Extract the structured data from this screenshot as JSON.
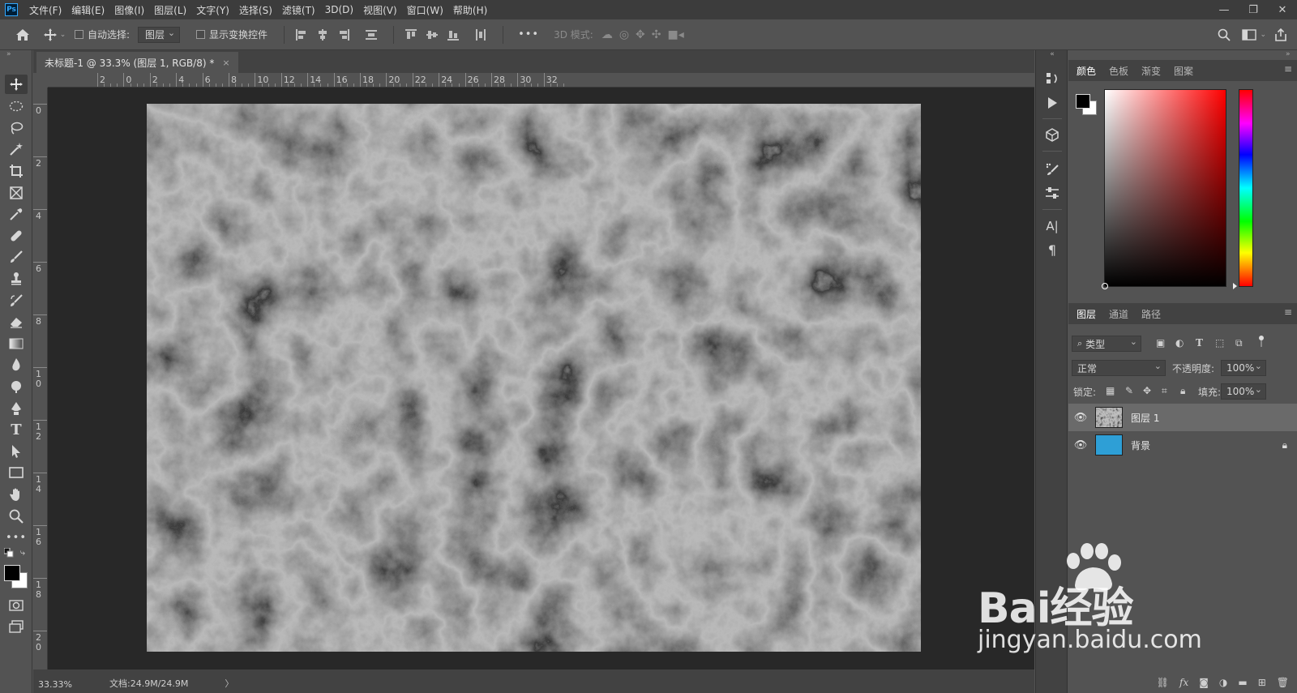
{
  "app": {
    "logo_text": "Ps"
  },
  "menu": [
    "文件(F)",
    "编辑(E)",
    "图像(I)",
    "图层(L)",
    "文字(Y)",
    "选择(S)",
    "滤镜(T)",
    "3D(D)",
    "视图(V)",
    "窗口(W)",
    "帮助(H)"
  ],
  "window_controls": {
    "minimize": "—",
    "restore": "❐",
    "close": "✕"
  },
  "options_bar": {
    "auto_select_label": "自动选择:",
    "auto_select_target": "图层",
    "show_transform_label": "显示变换控件",
    "more_label": "•••",
    "mode_3d_label": "3D 模式:"
  },
  "document": {
    "tab_title": "未标题-1 @ 33.3% (图层 1, RGB/8) *",
    "tab_close": "×",
    "ruler_h_labels": [
      "2",
      "0",
      "2",
      "4",
      "6",
      "8",
      "10",
      "12",
      "14",
      "16",
      "18",
      "20",
      "22",
      "24",
      "26",
      "28",
      "30",
      "32"
    ],
    "ruler_v_labels": [
      "0",
      "2",
      "4",
      "6",
      "8",
      "10",
      "12",
      "14",
      "16",
      "18",
      "20"
    ]
  },
  "status": {
    "zoom": "33.33%",
    "doc_size": "文档:24.9M/24.9M",
    "arrow": "〉"
  },
  "color_panel": {
    "tabs": [
      "颜色",
      "色板",
      "渐变",
      "图案"
    ],
    "active_tab": 0,
    "foreground": "#000000",
    "background": "#ffffff",
    "hue": "#ff0000"
  },
  "layers_panel": {
    "tabs": [
      "图层",
      "通道",
      "路径"
    ],
    "active_tab": 0,
    "filter_label": "类型",
    "blend_mode": "正常",
    "opacity_label": "不透明度:",
    "opacity_value": "100%",
    "lock_label": "锁定:",
    "fill_label": "填充:",
    "fill_value": "100%",
    "layers": [
      {
        "name": "图层 1",
        "selected": true,
        "visible": true,
        "locked": false
      },
      {
        "name": "背景",
        "selected": false,
        "visible": true,
        "locked": true,
        "color": "#2e9fd6"
      }
    ]
  },
  "watermark": {
    "brand": "Bai经验",
    "url": "jingyan.baidu.com"
  }
}
